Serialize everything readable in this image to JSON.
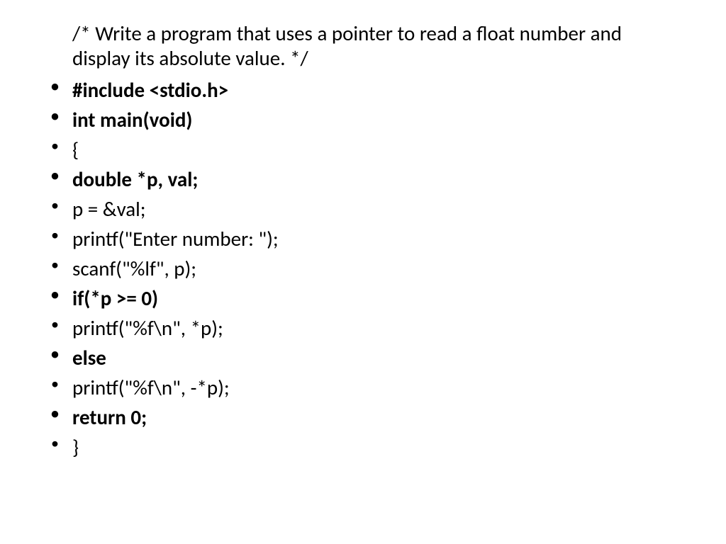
{
  "comment": "/* Write a program that uses a pointer to read a float number and display its absolute value. */",
  "lines": [
    {
      "text": "#include <stdio.h>",
      "bold": true
    },
    {
      "text": "int main(void)",
      "bold": true
    },
    {
      "text": "{",
      "bold": false
    },
    {
      "text": "double *p, val;",
      "bold": true
    },
    {
      "text": "p = &val;",
      "bold": false
    },
    {
      "text": "printf(\"Enter number: \");",
      "bold": false
    },
    {
      "text": "scanf(\"%lf\", p);",
      "bold": false
    },
    {
      "text": "if(*p >= 0)",
      "bold": true
    },
    {
      "text": "printf(\"%f\\n\", *p);",
      "bold": false
    },
    {
      "text": "else",
      "bold": true
    },
    {
      "text": "printf(\"%f\\n\", -*p);",
      "bold": false
    },
    {
      "text": "return 0;",
      "bold": true
    },
    {
      "text": "}",
      "bold": false
    }
  ]
}
